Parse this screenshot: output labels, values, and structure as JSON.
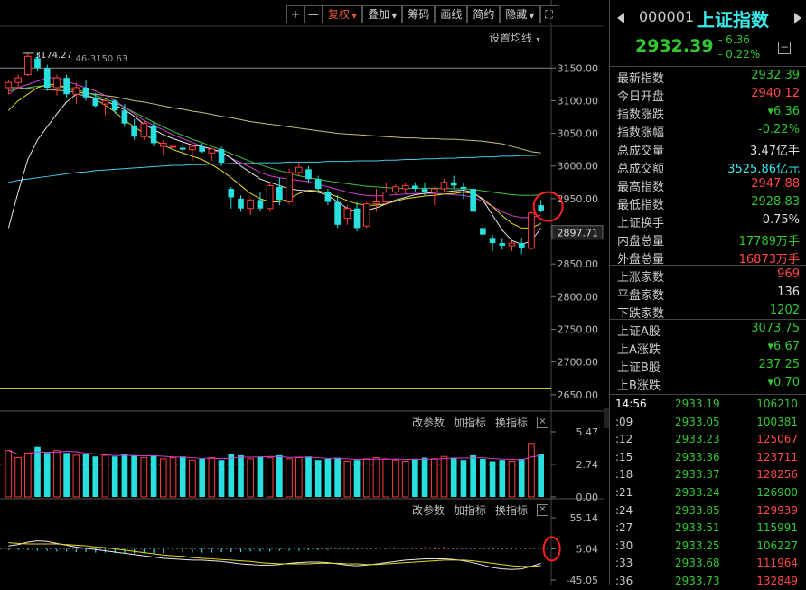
{
  "toolbar": {
    "plus": "+",
    "minus": "—",
    "fuquan": "复权",
    "diejia": "叠加",
    "choumai": "筹码",
    "huaxian": "画线",
    "jianyue": "简约",
    "yincang": "隐藏",
    "fullscreen": "⛶"
  },
  "main_chart": {
    "ma_setting": "设置均线",
    "high_label": "3174.27",
    "top_left_label": "46-3150.63",
    "price_tag": "2897.71",
    "y_ticks": [
      "3150.00",
      "3100.00",
      "3050.00",
      "3000.00",
      "2950.00",
      "2900.00",
      "2850.00",
      "2800.00",
      "2750.00",
      "2700.00",
      "2650.00"
    ]
  },
  "volume_panel": {
    "btn_params": "改参数",
    "btn_add": "加指标",
    "btn_switch": "换指标",
    "close": "×",
    "y_ticks": [
      "5.47",
      "2.74",
      "0.00"
    ]
  },
  "macd_panel": {
    "btn_params": "改参数",
    "btn_add": "加指标",
    "btn_switch": "换指标",
    "close": "×",
    "y_ticks": [
      "55.14",
      "5.04",
      "-45.05"
    ]
  },
  "quote": {
    "code": "000001",
    "name": "上证指数",
    "price": "2932.39",
    "change": "- 6.36",
    "change_pct": "- 0.22%",
    "collapse": "−",
    "stats_a": [
      {
        "k": "最新指数",
        "v": "2932.39",
        "color": "g"
      },
      {
        "k": "今日开盘",
        "v": "2940.12",
        "color": "r"
      },
      {
        "k": "指数涨跌",
        "v": "▾6.36",
        "color": "g"
      },
      {
        "k": "指数涨幅",
        "v": "-0.22%",
        "color": "g"
      },
      {
        "k": "总成交量",
        "v": "3.47亿手",
        "color": "w"
      },
      {
        "k": "总成交额",
        "v": "3525.86亿元",
        "color": "c"
      },
      {
        "k": "最高指数",
        "v": "2947.88",
        "color": "r"
      },
      {
        "k": "最低指数",
        "v": "2928.83",
        "color": "g"
      }
    ],
    "stats_b": [
      {
        "k": "上证换手",
        "v": "0.75%",
        "color": "w"
      },
      {
        "k": "内盘总量",
        "v": "17789万手",
        "color": "g"
      },
      {
        "k": "外盘总量",
        "v": "16873万手",
        "color": "r"
      }
    ],
    "stats_c": [
      {
        "k": "上涨家数",
        "v": "969",
        "color": "r"
      },
      {
        "k": "平盘家数",
        "v": "136",
        "color": "w"
      },
      {
        "k": "下跌家数",
        "v": "1202",
        "color": "g"
      }
    ],
    "stats_d": [
      {
        "k": "上证A股",
        "v": "3073.75",
        "color": "g"
      },
      {
        "k": "上A涨跌",
        "v": "▾6.67",
        "color": "g"
      },
      {
        "k": "上证B股",
        "v": "237.25",
        "color": "g"
      },
      {
        "k": "上B涨跌",
        "v": "▾0.70",
        "color": "g"
      }
    ],
    "ticks": [
      {
        "t": "14:56",
        "p": "2933.19",
        "v": "106210",
        "color": "g"
      },
      {
        "t": ":09",
        "p": "2933.05",
        "v": "100381",
        "color": "g"
      },
      {
        "t": ":12",
        "p": "2933.23",
        "v": "125067",
        "color": "r"
      },
      {
        "t": ":15",
        "p": "2933.36",
        "v": "123711",
        "color": "r"
      },
      {
        "t": ":18",
        "p": "2933.37",
        "v": "128256",
        "color": "r"
      },
      {
        "t": ":21",
        "p": "2933.24",
        "v": "126900",
        "color": "g"
      },
      {
        "t": ":24",
        "p": "2933.85",
        "v": "129939",
        "color": "r"
      },
      {
        "t": ":27",
        "p": "2933.51",
        "v": "115991",
        "color": "g"
      },
      {
        "t": ":30",
        "p": "2933.25",
        "v": "106227",
        "color": "g"
      },
      {
        "t": ":33",
        "p": "2933.68",
        "v": "111964",
        "color": "r"
      },
      {
        "t": ":36",
        "p": "2933.73",
        "v": "132849",
        "color": "r"
      }
    ]
  },
  "chart_data": {
    "type": "candlestick",
    "y_range": [
      2640,
      3185
    ],
    "candles": [
      [
        3120,
        3132,
        3110,
        3128
      ],
      [
        3128,
        3140,
        3120,
        3135
      ],
      [
        3140,
        3172,
        3138,
        3168
      ],
      [
        3165,
        3174,
        3145,
        3150
      ],
      [
        3150,
        3155,
        3115,
        3120
      ],
      [
        3120,
        3140,
        3108,
        3135
      ],
      [
        3135,
        3140,
        3105,
        3110
      ],
      [
        3110,
        3128,
        3095,
        3120
      ],
      [
        3120,
        3132,
        3100,
        3105
      ],
      [
        3105,
        3112,
        3090,
        3092
      ],
      [
        3095,
        3102,
        3078,
        3100
      ],
      [
        3100,
        3102,
        3080,
        3085
      ],
      [
        3085,
        3095,
        3060,
        3065
      ],
      [
        3062,
        3072,
        3040,
        3045
      ],
      [
        3045,
        3070,
        3040,
        3065
      ],
      [
        3062,
        3068,
        3030,
        3035
      ],
      [
        3030,
        3040,
        3018,
        3035
      ],
      [
        3030,
        3038,
        3010,
        3030
      ],
      [
        3028,
        3035,
        3015,
        3025
      ],
      [
        3025,
        3030,
        3008,
        3030
      ],
      [
        3030,
        3035,
        3020,
        3022
      ],
      [
        3020,
        3028,
        3008,
        3026
      ],
      [
        3026,
        3030,
        3000,
        3005
      ],
      [
        2965,
        2968,
        2935,
        2952
      ],
      [
        2950,
        2955,
        2930,
        2935
      ],
      [
        2935,
        2950,
        2925,
        2948
      ],
      [
        2948,
        2960,
        2930,
        2935
      ],
      [
        2935,
        2975,
        2930,
        2970
      ],
      [
        2968,
        2982,
        2940,
        2948
      ],
      [
        2945,
        2995,
        2942,
        2990
      ],
      [
        2990,
        3005,
        2985,
        2998
      ],
      [
        2995,
        3000,
        2975,
        2980
      ],
      [
        2980,
        2985,
        2958,
        2965
      ],
      [
        2960,
        2965,
        2940,
        2945
      ],
      [
        2945,
        2955,
        2905,
        2910
      ],
      [
        2920,
        2940,
        2910,
        2935
      ],
      [
        2935,
        2945,
        2900,
        2905
      ],
      [
        2908,
        2945,
        2905,
        2942
      ],
      [
        2942,
        2965,
        2930,
        2945
      ],
      [
        2945,
        2975,
        2940,
        2960
      ],
      [
        2960,
        2972,
        2955,
        2968
      ],
      [
        2965,
        2975,
        2958,
        2970
      ],
      [
        2970,
        2975,
        2960,
        2965
      ],
      [
        2965,
        2975,
        2955,
        2960
      ],
      [
        2960,
        2968,
        2940,
        2965
      ],
      [
        2965,
        2980,
        2960,
        2975
      ],
      [
        2975,
        2985,
        2965,
        2970
      ],
      [
        2968,
        2975,
        2950,
        2965
      ],
      [
        2965,
        2970,
        2925,
        2930
      ],
      [
        2905,
        2910,
        2890,
        2895
      ],
      [
        2890,
        2895,
        2870,
        2882
      ],
      [
        2882,
        2890,
        2872,
        2878
      ],
      [
        2878,
        2885,
        2870,
        2882
      ],
      [
        2882,
        2890,
        2865,
        2874
      ],
      [
        2874,
        2930,
        2872,
        2928
      ],
      [
        2940,
        2948,
        2929,
        2932
      ]
    ],
    "ma_white": [
      2905,
      2960,
      3010,
      3040,
      3060,
      3080,
      3098,
      3110,
      3108,
      3104,
      3100,
      3093,
      3086,
      3076,
      3064,
      3056,
      3048,
      3042,
      3037,
      3032,
      3030,
      3026,
      3022,
      3012,
      3000,
      2990,
      2980,
      2975,
      2970,
      2965,
      2963,
      2962,
      2960,
      2955,
      2945,
      2935,
      2930,
      2932,
      2936,
      2942,
      2948,
      2952,
      2956,
      2958,
      2960,
      2960,
      2962,
      2963,
      2960,
      2948,
      2925,
      2902,
      2886,
      2880,
      2885,
      2905
    ],
    "ma_yellow": [
      3085,
      3100,
      3110,
      3120,
      3125,
      3125,
      3120,
      3115,
      3110,
      3102,
      3093,
      3083,
      3070,
      3060,
      3050,
      3040,
      3032,
      3025,
      3020,
      3015,
      3010,
      3002,
      2993,
      2982,
      2970,
      2958,
      2950,
      2945,
      2945,
      2950,
      2958,
      2963,
      2962,
      2958,
      2953,
      2947,
      2942,
      2940,
      2940,
      2942,
      2946,
      2950,
      2952,
      2954,
      2955,
      2957,
      2958,
      2960,
      2958,
      2950,
      2938,
      2924,
      2912,
      2905,
      2905,
      2912
    ],
    "ma_magenta": [
      3110,
      3120,
      3125,
      3130,
      3135,
      3135,
      3130,
      3125,
      3120,
      3115,
      3108,
      3100,
      3090,
      3080,
      3070,
      3062,
      3055,
      3048,
      3042,
      3036,
      3030,
      3025,
      3020,
      3012,
      3005,
      2998,
      2990,
      2985,
      2982,
      2980,
      2978,
      2976,
      2972,
      2968,
      2964,
      2960,
      2957,
      2955,
      2954,
      2955,
      2956,
      2957,
      2958,
      2958,
      2958,
      2957,
      2956,
      2955,
      2952,
      2946,
      2938,
      2930,
      2924,
      2921,
      2921,
      2925
    ],
    "ma_green": [
      3115,
      3118,
      3120,
      3122,
      3123,
      3122,
      3120,
      3117,
      3113,
      3108,
      3103,
      3097,
      3090,
      3082,
      3075,
      3067,
      3060,
      3053,
      3047,
      3041,
      3036,
      3030,
      3025,
      3019,
      3013,
      3007,
      3002,
      2997,
      2993,
      2989,
      2985,
      2982,
      2980,
      2977,
      2975,
      2973,
      2971,
      2969,
      2968,
      2967,
      2966,
      2966,
      2966,
      2966,
      2966,
      2966,
      2965,
      2965,
      2964,
      2962,
      2960,
      2958,
      2956,
      2955,
      2955,
      2956
    ],
    "ma_khaki": [
      3120,
      3120,
      3119,
      3118,
      3117,
      3116,
      3115,
      3113,
      3112,
      3110,
      3108,
      3106,
      3103,
      3100,
      3098,
      3095,
      3092,
      3089,
      3087,
      3084,
      3082,
      3079,
      3076,
      3074,
      3071,
      3068,
      3066,
      3064,
      3062,
      3060,
      3058,
      3056,
      3054,
      3052,
      3050,
      3049,
      3048,
      3047,
      3046,
      3045,
      3044,
      3043,
      3043,
      3042,
      3042,
      3041,
      3041,
      3040,
      3039,
      3038,
      3036,
      3034,
      3030,
      3026,
      3022,
      3020
    ],
    "ma_cyan": [
      2975,
      2978,
      2980,
      2982,
      2984,
      2986,
      2988,
      2990,
      2991,
      2993,
      2994,
      2995,
      2996,
      2997,
      2998,
      2999,
      3000,
      3001,
      3001,
      3002,
      3002,
      3003,
      3003,
      3004,
      3004,
      3004,
      3005,
      3005,
      3005,
      3006,
      3006,
      3006,
      3006,
      3007,
      3007,
      3007,
      3008,
      3008,
      3008,
      3009,
      3009,
      3010,
      3010,
      3011,
      3011,
      3012,
      3012,
      3013,
      3013,
      3014,
      3014,
      3015,
      3015,
      3016,
      3016,
      3017
    ],
    "volume": [
      3.9,
      3.3,
      3.7,
      4.2,
      3.7,
      3.9,
      3.7,
      3.5,
      3.6,
      3.4,
      3.5,
      3.4,
      3.6,
      3.5,
      3.3,
      3.5,
      3.2,
      3.3,
      3.4,
      3.1,
      3.2,
      3.3,
      3.1,
      3.6,
      3.5,
      3.2,
      3.4,
      3.3,
      3.5,
      3.2,
      3.3,
      3.4,
      3.1,
      3.2,
      3.3,
      3.0,
      3.1,
      3.2,
      3.3,
      3.2,
      3.1,
      3.0,
      3.2,
      3.3,
      3.2,
      3.4,
      3.3,
      3.1,
      3.5,
      3.2,
      3.0,
      3.1,
      3.0,
      3.2,
      4.5,
      3.6
    ],
    "macd": [
      -2,
      -2,
      -2,
      -3,
      -3,
      -4,
      -4,
      -5,
      -5,
      -6,
      -6,
      -7,
      -7,
      -7,
      -7,
      -7,
      -7,
      -7,
      -6,
      -6,
      -6,
      -6,
      -5,
      -5,
      -5,
      -4,
      -4,
      -4,
      -3,
      -3,
      -3,
      -2,
      -2,
      -2,
      -1,
      -1,
      -1,
      0,
      1,
      1,
      2,
      2,
      2,
      3,
      3,
      3,
      2,
      2,
      1,
      -1,
      -1,
      -1,
      -1,
      0,
      1,
      2
    ],
    "diff": [
      10,
      12,
      16,
      18,
      17,
      14,
      11,
      8,
      6,
      4,
      2,
      0,
      -2,
      -4,
      -6,
      -8,
      -10,
      -11,
      -12,
      -13,
      -13,
      -14,
      -15,
      -17,
      -19,
      -20,
      -21,
      -21,
      -20,
      -18,
      -17,
      -16,
      -16,
      -17,
      -19,
      -21,
      -22,
      -21,
      -19,
      -17,
      -15,
      -13,
      -12,
      -11,
      -11,
      -11,
      -12,
      -14,
      -17,
      -21,
      -25,
      -27,
      -28,
      -27,
      -23,
      -18
    ],
    "dea": [
      15,
      14,
      13,
      13,
      13,
      13,
      12,
      11,
      10,
      8,
      7,
      5,
      3,
      1,
      -1,
      -3,
      -5,
      -6,
      -7,
      -9,
      -10,
      -11,
      -12,
      -13,
      -14,
      -15,
      -17,
      -18,
      -19,
      -19,
      -19,
      -19,
      -18,
      -18,
      -18,
      -19,
      -19,
      -20,
      -20,
      -19,
      -18,
      -17,
      -16,
      -15,
      -14,
      -13,
      -13,
      -13,
      -14,
      -16,
      -18,
      -20,
      -22,
      -23,
      -23,
      -22
    ]
  }
}
